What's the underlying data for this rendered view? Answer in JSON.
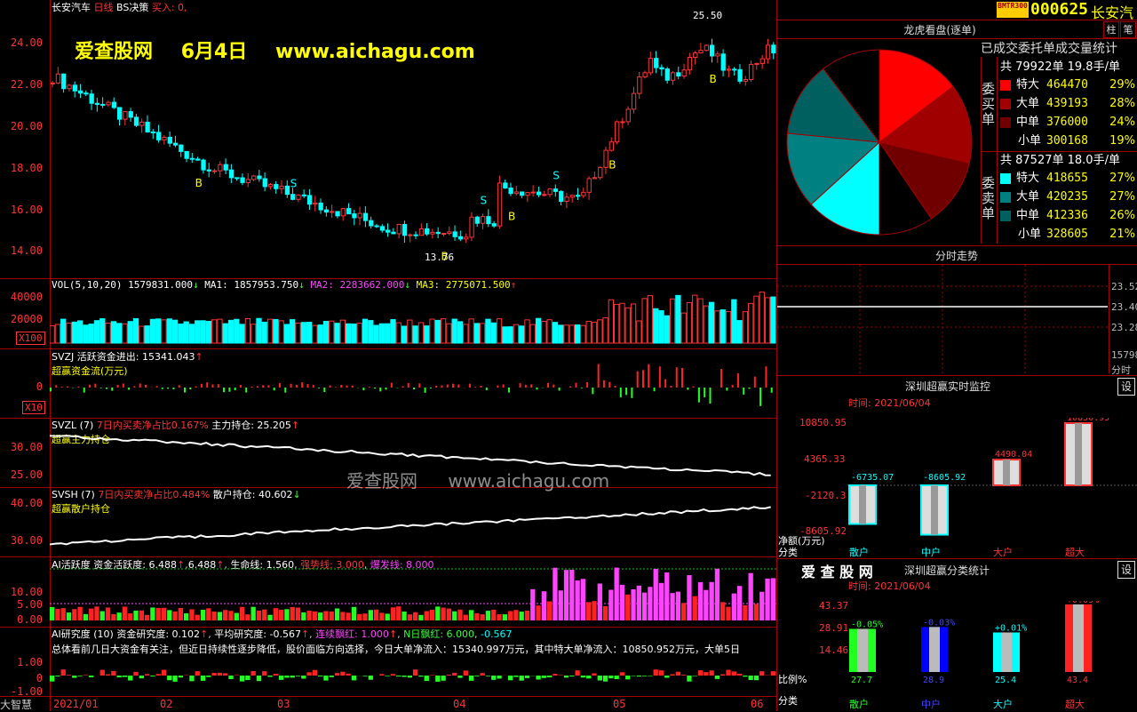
{
  "header": {
    "stock_name": "长安汽车",
    "period": "日线",
    "indicator": "BS决策",
    "buy_label": "买入: 0,"
  },
  "watermark": {
    "brand": "爱查股网",
    "date": "6月4日",
    "url": "www.aichagu.com",
    "center_brand": "爱查股网",
    "center_url": "www.aichagu.com"
  },
  "main_chart": {
    "y_ticks": [
      "24.00",
      "22.00",
      "20.00",
      "18.00",
      "16.00",
      "14.00"
    ],
    "high_label": "25.50",
    "low_label": "13.76",
    "signal_labels": [
      "B",
      "S"
    ]
  },
  "vol_panel": {
    "formula": "VOL(5,10,20)",
    "vol": "1579831.000",
    "ma1": "MA1: 1857953.750",
    "ma2": "MA2: 2283662.000",
    "ma3": "MA3: 2775071.500",
    "y_ticks": [
      "40000",
      "20000"
    ],
    "multiplier": "X100"
  },
  "svzj_panel": {
    "name": "SVZJ",
    "active_flow": "活跃资金进出: 15341.043",
    "subtitle": "超赢资金流(万元)",
    "y_ticks": [
      "0"
    ],
    "multiplier": "X10"
  },
  "svzl_panel": {
    "name": "SVZL (7)",
    "ratio": "7日内买卖净占比0.167%",
    "holding": "主力持仓: 25.205",
    "subtitle": "超赢主力持仓",
    "y_ticks": [
      "30.00",
      "25.00"
    ]
  },
  "svsh_panel": {
    "name": "SVSH (7)",
    "ratio": "7日内买卖净占比0.484%",
    "holding": "散户持仓: 40.602",
    "subtitle": "超赢散户持仓",
    "y_ticks": [
      "40.00",
      "30.00"
    ]
  },
  "ai_active_panel": {
    "name": "AI活跃度",
    "active": "资金活跃度: 6.488",
    "active2": "6.488",
    "life": "生命线: 1.560",
    "strong": "强势线: 3.000",
    "burst": "爆发线: 8.000",
    "y_ticks": [
      "10.00",
      "5.00",
      "0.00"
    ]
  },
  "ai_research_panel": {
    "name": "AI研究度 (10)",
    "research": "资金研究度: 0.102",
    "avg": "平均研究度: -0.567",
    "streak": "连续飘红: 1.000",
    "n_red": "N日飘红: 6.000",
    "neg": "-0.567",
    "summary": "总体看前几日大资金有关注，但近日持续性逐步降低，股价面临方向选择，今日大单净流入：15340.997万元，其中特大单净流入：10850.952万元，大单5日",
    "y_ticks": [
      "1.00",
      "0",
      "-1.00"
    ]
  },
  "x_axis": {
    "labels": [
      "2021/01",
      "02",
      "03",
      "04",
      "05",
      "06"
    ],
    "brand": "大智慧"
  },
  "right_header": {
    "badge": "BMTR300",
    "code": "000625",
    "name": "长安汽",
    "btn_zhu": "柱",
    "btn_bi": "笔"
  },
  "dragon": {
    "title": "龙虎看盘(逐单)",
    "subtitle": "已成交委托单成交量统计",
    "buy_label": "委买单",
    "sell_label": "委卖单",
    "buy_total": "共 79922单 19.8手/单",
    "sell_total": "共 87527单 18.0手/单",
    "buy_rows": [
      {
        "name": "特大",
        "value": "464470",
        "pct": "29%",
        "color": "#ff0000"
      },
      {
        "name": "大单",
        "value": "439193",
        "pct": "28%",
        "color": "#a00000"
      },
      {
        "name": "中单",
        "value": "376000",
        "pct": "24%",
        "color": "#700000"
      },
      {
        "name": "小单",
        "value": "300168",
        "pct": "19%",
        "color": "#000000"
      }
    ],
    "sell_rows": [
      {
        "name": "特大",
        "value": "418655",
        "pct": "27%",
        "color": "#00ffff"
      },
      {
        "name": "大单",
        "value": "420235",
        "pct": "27%",
        "color": "#008080"
      },
      {
        "name": "中单",
        "value": "412336",
        "pct": "26%",
        "color": "#006060"
      },
      {
        "name": "小单",
        "value": "328605",
        "pct": "21%",
        "color": "#000000"
      }
    ]
  },
  "intraday": {
    "title": "分时走势",
    "y_ticks": [
      "23.52",
      "23.40",
      "23.28",
      "15798",
      "分时"
    ]
  },
  "monitor": {
    "title": "深圳超赢实时监控",
    "settings": "设",
    "time": "时间: 2021/06/04",
    "y_ticks": [
      "10850.95",
      "4365.33",
      "-2120.3",
      "-8605.92"
    ],
    "ylabel": "净额(万元)",
    "xlabel": "分类",
    "categories": [
      "散户",
      "中户",
      "大户",
      "超大"
    ],
    "values": [
      "-6735.07",
      "-8605.92",
      "4490.04",
      "10850.95"
    ]
  },
  "classify": {
    "brand": "爱 查 股 网",
    "title": "深圳超赢分类统计",
    "settings": "设",
    "time": "时间: 2021/06/04",
    "y_ticks": [
      "43.37",
      "28.91",
      "14.46"
    ],
    "ylabel": "比例%",
    "xlabel": "分类",
    "categories": [
      "散户",
      "中户",
      "大户",
      "超大"
    ],
    "changes": [
      "-0.05%",
      "-0.03%",
      "+0.01%",
      "+0.09%"
    ],
    "values": [
      "27.7",
      "28.9",
      "25.4",
      "43.4"
    ]
  },
  "chart_data": {
    "type": "pie",
    "title": "龙虎看盘(逐单)",
    "categories": [
      "买特大",
      "买大单",
      "买中单",
      "买小单",
      "卖特大",
      "卖大单",
      "卖中单",
      "卖小单"
    ],
    "values": [
      464470,
      439193,
      376000,
      300168,
      418655,
      420235,
      412336,
      328605
    ]
  }
}
